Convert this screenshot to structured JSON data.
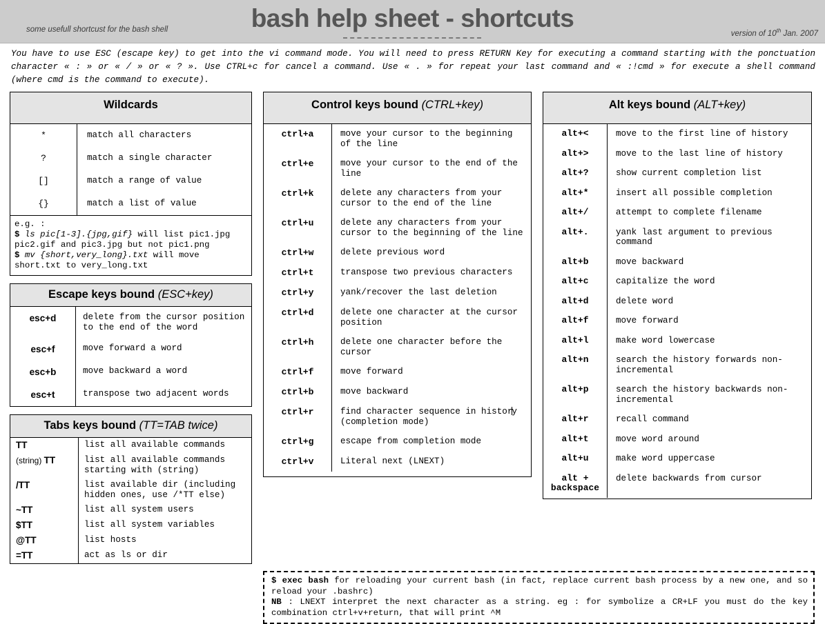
{
  "header": {
    "subtitle": "some usefull shortcust for the bash shell",
    "title": "bash help sheet - shortcuts",
    "version_prefix": "version of 10",
    "version_sup": "th",
    "version_suffix": " Jan. 2007"
  },
  "intro": "You have to use ESC (escape key) to get into the vi command mode. You will need to press RETURN Key for executing a command starting with the ponctuation character « : » or « / » or « ? ». Use CTRL+c for cancel a command. Use « . » for repeat your last command and « :!cmd » for execute a shell command (where cmd is the command to execute).",
  "wildcards": {
    "title": "Wildcards",
    "rows": [
      {
        "key": "*",
        "desc": "match all characters"
      },
      {
        "key": "?",
        "desc": "match a single character"
      },
      {
        "key": "[]",
        "desc": "match a range of value"
      },
      {
        "key": "{}",
        "desc": "match a list of value"
      }
    ],
    "note": {
      "line1": "e.g. :",
      "line2_prefix": "$ ",
      "line2_em": "ls pic[1-3].{jpg,gif}",
      "line2_rest": " will list pic1.jpg",
      "line3": "pic2.gif and pic3.jpg but not pic1.png",
      "line4_prefix": "$ ",
      "line4_em": "mv {short,very_long}.txt",
      "line4_rest": " will move",
      "line5": "short.txt to very_long.txt"
    }
  },
  "escape_keys": {
    "title": "Escape keys bound",
    "hint": "(ESC+key)",
    "rows": [
      {
        "key": "esc+d",
        "desc": "delete from the cursor position to the end of the word"
      },
      {
        "key": "esc+f",
        "desc": "move forward a word"
      },
      {
        "key": "esc+b",
        "desc": "move backward a word"
      },
      {
        "key": "esc+t",
        "desc": "transpose two adjacent words"
      }
    ]
  },
  "tabs_keys": {
    "title": "Tabs keys bound",
    "hint": "(TT=TAB twice)",
    "rows": [
      {
        "key": "TT",
        "key_thin": "",
        "desc": "list all available commands"
      },
      {
        "key": "TT",
        "key_thin": "(string) ",
        "desc": "list all available commands starting with (string)"
      },
      {
        "key": "/TT",
        "key_thin": "",
        "desc": "list available dir (including hidden ones, use /*TT else)"
      },
      {
        "key": "~TT",
        "key_thin": "",
        "desc": "list all system users"
      },
      {
        "key": "$TT",
        "key_thin": "",
        "desc": "list all system variables"
      },
      {
        "key": "@TT",
        "key_thin": "",
        "desc": "list hosts"
      },
      {
        "key": "=TT",
        "key_thin": "",
        "desc": "act as ls or dir"
      }
    ]
  },
  "control_keys": {
    "title": "Control keys bound",
    "hint": "(CTRL+key)",
    "rows": [
      {
        "key": "ctrl+a",
        "desc": "move your cursor to the beginning of the line"
      },
      {
        "key": "ctrl+e",
        "desc": "move your cursor to the end of the line"
      },
      {
        "key": "ctrl+k",
        "desc": "delete any characters from your cursor to the end of the line"
      },
      {
        "key": "ctrl+u",
        "desc": "delete any characters from your cursor to the beginning of the line"
      },
      {
        "key": "ctrl+w",
        "desc": "delete previous word"
      },
      {
        "key": "ctrl+t",
        "desc": "transpose two previous characters"
      },
      {
        "key": "ctrl+y",
        "desc": "yank/recover the last deletion"
      },
      {
        "key": "ctrl+d",
        "desc": "delete one character at the cursor position"
      },
      {
        "key": "ctrl+h",
        "desc": "delete one character before the cursor"
      },
      {
        "key": "ctrl+f",
        "desc": "move forward"
      },
      {
        "key": "ctrl+b",
        "desc": "move backward"
      },
      {
        "key": "ctrl+r",
        "desc": "find character sequence in history (completion mode)"
      },
      {
        "key": "ctrl+g",
        "desc": "escape from completion mode"
      },
      {
        "key": "ctrl+v",
        "desc": "Literal next (LNEXT)"
      }
    ]
  },
  "alt_keys": {
    "title": "Alt keys bound",
    "hint": "(ALT+key)",
    "rows": [
      {
        "key": "alt+<",
        "desc": "move to the first line of history"
      },
      {
        "key": "alt+>",
        "desc": "move to the last line of history"
      },
      {
        "key": "alt+?",
        "desc": "show current completion list"
      },
      {
        "key": "alt+*",
        "desc": "insert all possible completion"
      },
      {
        "key": "alt+/",
        "desc": "attempt to complete filename"
      },
      {
        "key": "alt+.",
        "desc": "yank last argument to previous command"
      },
      {
        "key": "alt+b",
        "desc": "move backward"
      },
      {
        "key": "alt+c",
        "desc": "capitalize the word"
      },
      {
        "key": "alt+d",
        "desc": "delete word"
      },
      {
        "key": "alt+f",
        "desc": "move forward"
      },
      {
        "key": "alt+l",
        "desc": "make word lowercase"
      },
      {
        "key": "alt+n",
        "desc": "search the history forwards non-incremental"
      },
      {
        "key": "alt+p",
        "desc": "search the history backwards non-incremental"
      },
      {
        "key": "alt+r",
        "desc": "recall command"
      },
      {
        "key": "alt+t",
        "desc": "move word around"
      },
      {
        "key": "alt+u",
        "desc": "make word uppercase"
      },
      {
        "key": "alt + backspace",
        "desc": "delete backwards from cursor"
      }
    ]
  },
  "footnote": {
    "line1_cmd": "$ exec bash",
    "line1_rest": " for reloading your current bash (in fact, replace current bash process by a new one, and so reload your .bashrc)",
    "line2_label": "NB",
    "line2_rest": " : LNEXT interpret the next character as a string. eg : for symbolize a CR+LF you must do the key combination ctrl+v+return, that will print ^M"
  }
}
